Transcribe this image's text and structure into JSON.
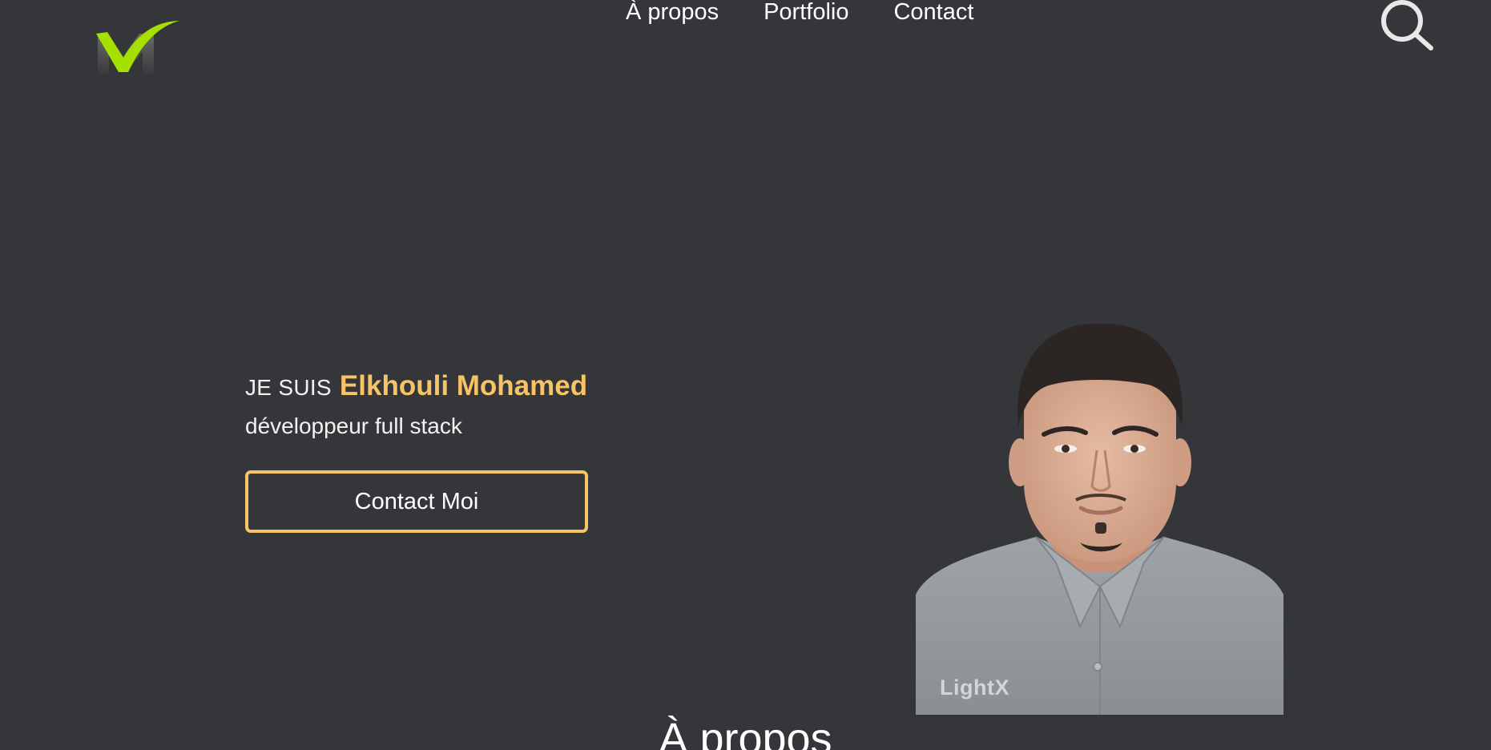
{
  "header": {
    "logo_icon": "checkmark-m-logo-icon",
    "nav": [
      {
        "label": "À propos"
      },
      {
        "label": "Portfolio"
      },
      {
        "label": "Contact"
      }
    ],
    "search_icon": "search-icon"
  },
  "hero": {
    "intro_prefix": "JE SUIS",
    "name": "Elkhouli Mohamed",
    "role": "développeur full stack",
    "cta_label": "Contact Moi",
    "portrait_watermark": "LightX"
  },
  "next_section": {
    "title": "À propos"
  },
  "colors": {
    "background": "#35363a",
    "accent": "#f8c365",
    "logo_green": "#a6e000",
    "text": "#ffffff"
  }
}
